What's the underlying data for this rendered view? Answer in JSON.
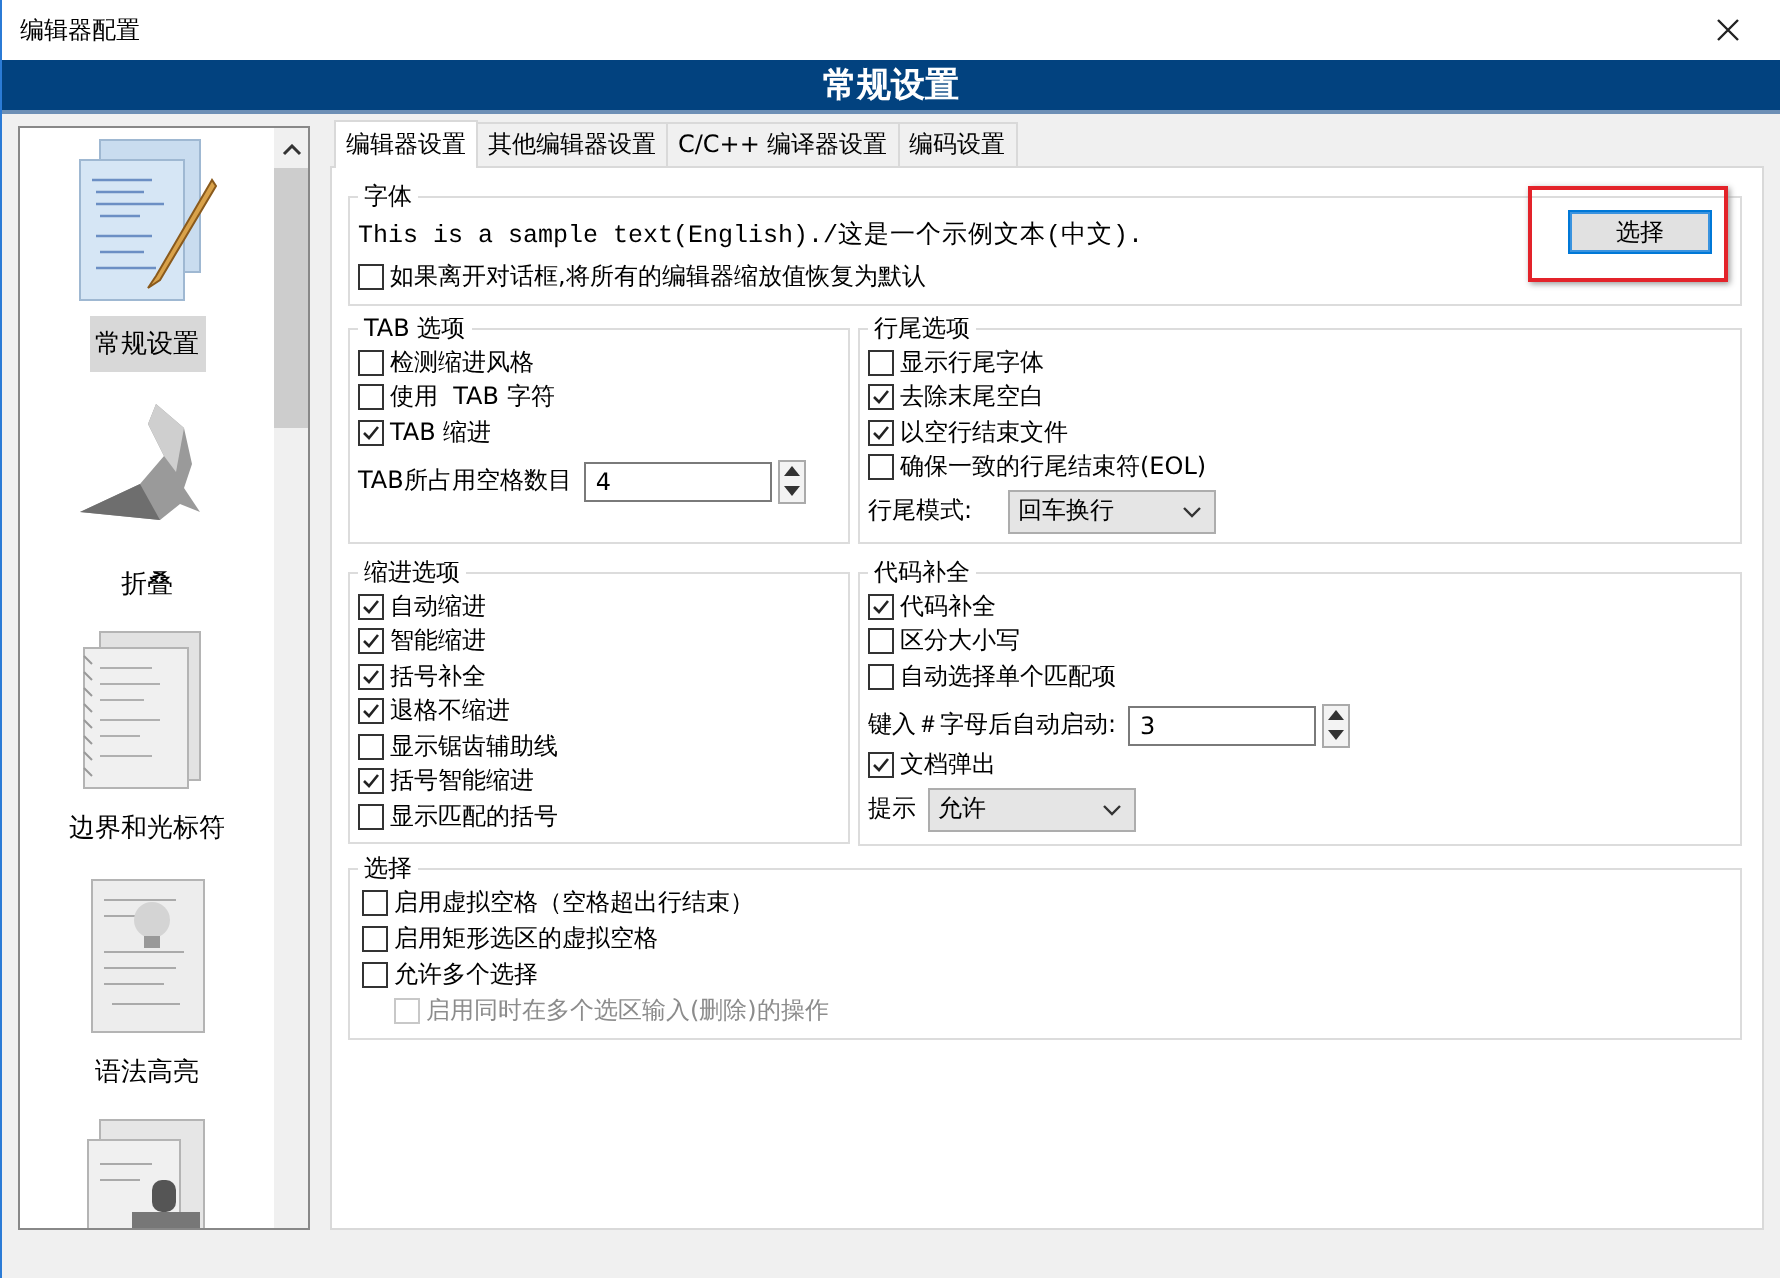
{
  "window": {
    "title": "编辑器配置"
  },
  "banner": {
    "title": "常规设置"
  },
  "sidebar": {
    "items": [
      {
        "label": "常规设置",
        "selected": true
      },
      {
        "label": "折叠",
        "selected": false
      },
      {
        "label": "边界和光标符",
        "selected": false
      },
      {
        "label": "语法高亮",
        "selected": false
      },
      {
        "selected": false
      }
    ]
  },
  "tabs": [
    {
      "label": "编辑器设置",
      "selected": true
    },
    {
      "label": "其他编辑器设置",
      "selected": false
    },
    {
      "label": "C/C++ 编译器设置",
      "selected": false
    },
    {
      "label": "编码设置",
      "selected": false
    }
  ],
  "font_group": {
    "title": "字体",
    "sample": "This is a sample text(English)./这是一个示例文本(中文).",
    "button": "选择",
    "reset": {
      "label": "如果离开对话框,将所有的编辑器缩放值恢复为默认",
      "checked": false
    }
  },
  "columns": [
    [
      {
        "title": "TAB 选项",
        "items": [
          {
            "kind": "checkbox",
            "label": "检测缩进风格",
            "checked": false
          },
          {
            "kind": "checkbox",
            "label": "使用  TAB 字符",
            "checked": false
          },
          {
            "kind": "checkbox",
            "label": "TAB 缩进",
            "checked": true
          },
          {
            "kind": "spin",
            "label": "TAB所占用空格数目",
            "value": "4"
          }
        ]
      },
      {
        "title": "缩进选项",
        "items": [
          {
            "kind": "checkbox",
            "label": "自动缩进",
            "checked": true
          },
          {
            "kind": "checkbox",
            "label": "智能缩进",
            "checked": true
          },
          {
            "kind": "checkbox",
            "label": "括号补全",
            "checked": true
          },
          {
            "kind": "checkbox",
            "label": "退格不缩进",
            "checked": true
          },
          {
            "kind": "checkbox",
            "label": "显示锯齿辅助线",
            "checked": false
          },
          {
            "kind": "checkbox",
            "label": "括号智能缩进",
            "checked": true
          },
          {
            "kind": "checkbox",
            "label": "显示匹配的括号",
            "checked": false
          }
        ]
      }
    ],
    [
      {
        "title": "行尾选项",
        "items": [
          {
            "kind": "checkbox",
            "label": "显示行尾字体",
            "checked": false
          },
          {
            "kind": "checkbox",
            "label": "去除末尾空白",
            "checked": true
          },
          {
            "kind": "checkbox",
            "label": "以空行结束文件",
            "checked": true
          },
          {
            "kind": "checkbox",
            "label": "确保一致的行尾结束符(EOL)",
            "checked": false
          },
          {
            "kind": "select",
            "label": "行尾模式:",
            "value": "回车换行"
          }
        ]
      },
      {
        "title": "代码补全",
        "items": [
          {
            "kind": "checkbox",
            "label": "代码补全",
            "checked": true
          },
          {
            "kind": "checkbox",
            "label": "区分大小写",
            "checked": false
          },
          {
            "kind": "checkbox",
            "label": "自动选择单个匹配项",
            "checked": false
          },
          {
            "kind": "spin",
            "label": "键入＃字母后自动启动:",
            "value": "3"
          },
          {
            "kind": "checkbox",
            "label": "文档弹出",
            "checked": true
          },
          {
            "kind": "select",
            "label": "提示",
            "value": "允许"
          }
        ]
      }
    ]
  ],
  "selection_group": {
    "title": "选择",
    "items": [
      {
        "kind": "checkbox",
        "label": "启用虚拟空格（空格超出行结束）",
        "checked": false,
        "disabled": false
      },
      {
        "kind": "checkbox",
        "label": "启用矩形选区的虚拟空格",
        "checked": false,
        "disabled": false
      },
      {
        "kind": "checkbox",
        "label": "允许多个选择",
        "checked": false,
        "disabled": false
      },
      {
        "kind": "sub-checkbox",
        "label": "启用同时在多个选区输入(删除)的操作",
        "checked": false,
        "disabled": true
      }
    ]
  }
}
